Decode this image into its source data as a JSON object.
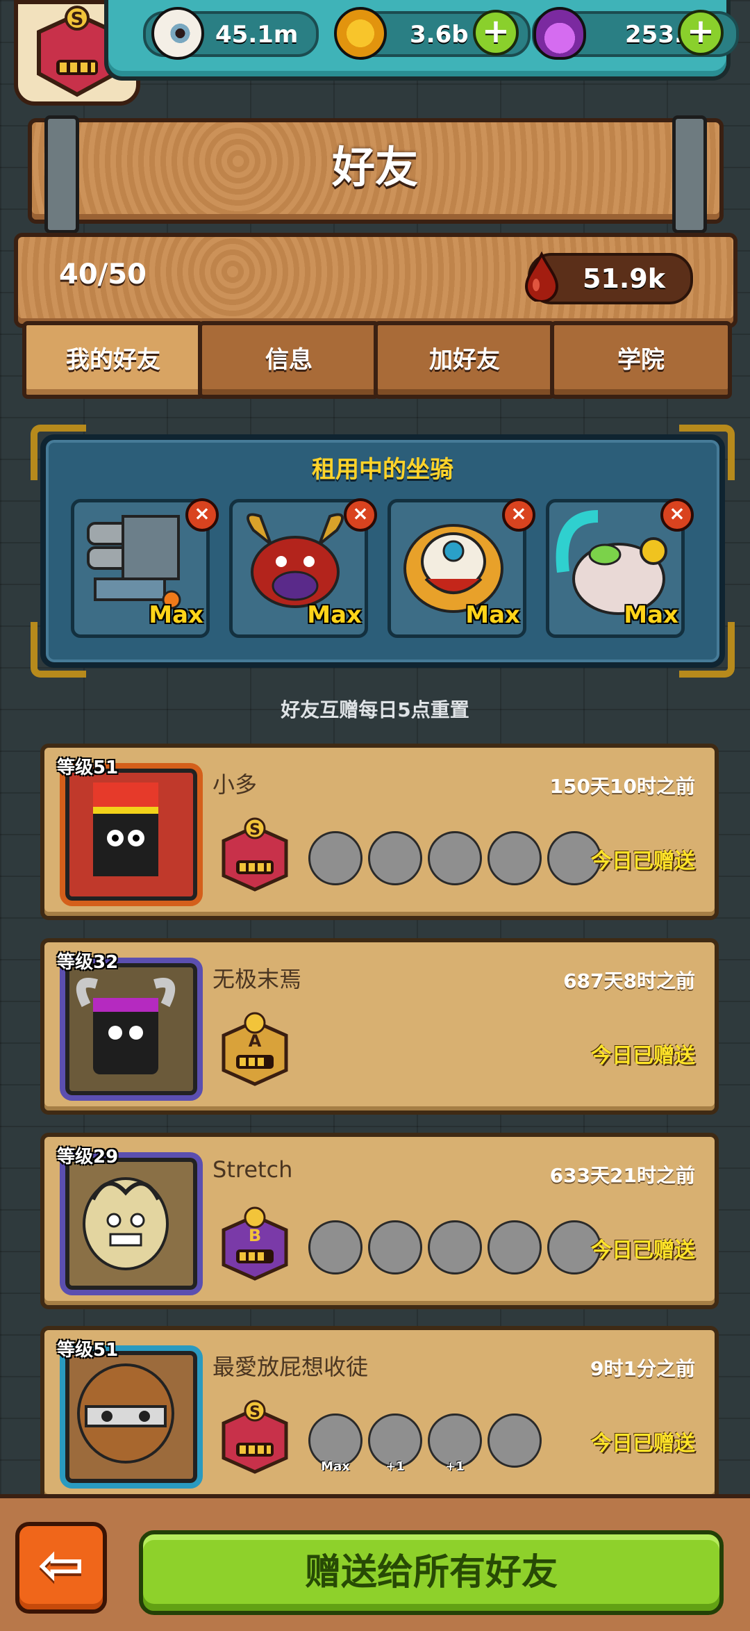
{
  "resources": {
    "eyes": "45.1m",
    "coins": "3.6b",
    "potion": "253.5k",
    "plus": "+"
  },
  "title": "好友",
  "friend_count": "40/50",
  "blood": "51.9k",
  "tabs": [
    "我的好友",
    "信息",
    "加好友",
    "学院"
  ],
  "mounts": {
    "title": "租用中的坐骑",
    "items": [
      {
        "label": "Max",
        "close": "×"
      },
      {
        "label": "Max",
        "close": "×"
      },
      {
        "label": "Max",
        "close": "×"
      },
      {
        "label": "Max",
        "close": "×"
      }
    ]
  },
  "reset_note": "好友互赠每日5点重置",
  "friends": [
    {
      "level": "等级51",
      "name": "小多",
      "time": "150天10时之前",
      "rank": "S",
      "sent": "今日已赠送",
      "monsters": [
        "",
        "",
        "",
        "",
        ""
      ]
    },
    {
      "level": "等级32",
      "name": "无极末焉",
      "time": "687天8时之前",
      "rank": "A",
      "sent": "今日已赠送",
      "monsters": []
    },
    {
      "level": "等级29",
      "name": "Stretch",
      "time": "633天21时之前",
      "rank": "B",
      "sent": "今日已赠送",
      "monsters": [
        "",
        "",
        "",
        "",
        ""
      ]
    },
    {
      "level": "等级51",
      "name": "最愛放屁想收徒",
      "time": "9时1分之前",
      "rank": "S",
      "sent": "今日已赠送",
      "monsters": [
        "Max",
        "+1",
        "+1",
        ""
      ]
    }
  ],
  "bottom": {
    "back": "⇦",
    "send_all": "赠送给所有好友"
  },
  "colors": {
    "accent_green": "#8ed12b",
    "rank_s": "#c8314a",
    "rank_a": "#d9a23a",
    "rank_b": "#7a3aa8"
  }
}
